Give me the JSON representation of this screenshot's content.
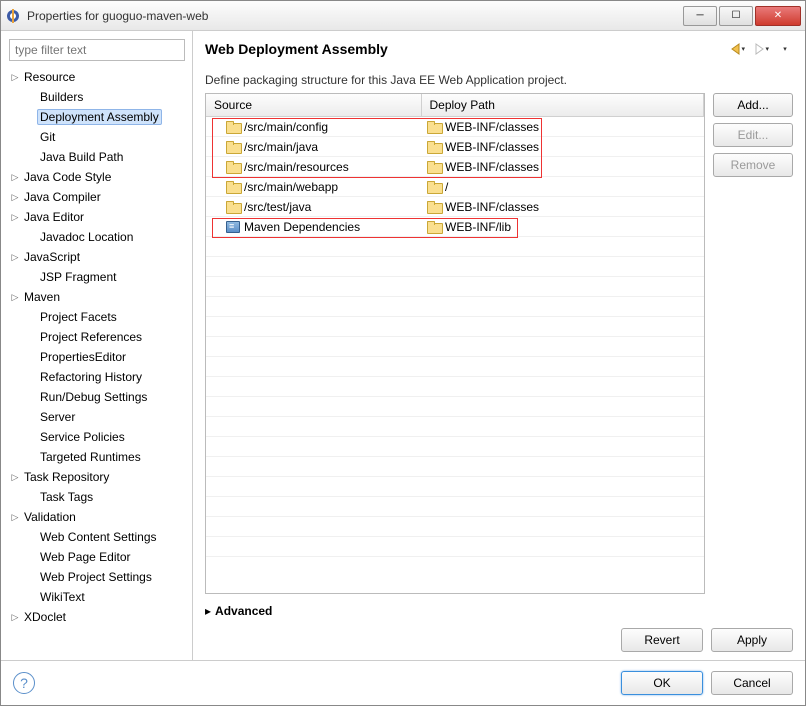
{
  "window": {
    "title": "Properties for guoguo-maven-web"
  },
  "sidebar": {
    "filter_placeholder": "type filter text",
    "items": [
      {
        "label": "Resource",
        "expandable": true,
        "depth": 0
      },
      {
        "label": "Builders",
        "expandable": false,
        "depth": 1
      },
      {
        "label": "Deployment Assembly",
        "expandable": false,
        "depth": 1,
        "selected": true
      },
      {
        "label": "Git",
        "expandable": false,
        "depth": 1
      },
      {
        "label": "Java Build Path",
        "expandable": false,
        "depth": 1
      },
      {
        "label": "Java Code Style",
        "expandable": true,
        "depth": 0
      },
      {
        "label": "Java Compiler",
        "expandable": true,
        "depth": 0
      },
      {
        "label": "Java Editor",
        "expandable": true,
        "depth": 0
      },
      {
        "label": "Javadoc Location",
        "expandable": false,
        "depth": 1
      },
      {
        "label": "JavaScript",
        "expandable": true,
        "depth": 0
      },
      {
        "label": "JSP Fragment",
        "expandable": false,
        "depth": 1
      },
      {
        "label": "Maven",
        "expandable": true,
        "depth": 0
      },
      {
        "label": "Project Facets",
        "expandable": false,
        "depth": 1
      },
      {
        "label": "Project References",
        "expandable": false,
        "depth": 1
      },
      {
        "label": "PropertiesEditor",
        "expandable": false,
        "depth": 1
      },
      {
        "label": "Refactoring History",
        "expandable": false,
        "depth": 1
      },
      {
        "label": "Run/Debug Settings",
        "expandable": false,
        "depth": 1
      },
      {
        "label": "Server",
        "expandable": false,
        "depth": 1
      },
      {
        "label": "Service Policies",
        "expandable": false,
        "depth": 1
      },
      {
        "label": "Targeted Runtimes",
        "expandable": false,
        "depth": 1
      },
      {
        "label": "Task Repository",
        "expandable": true,
        "depth": 0
      },
      {
        "label": "Task Tags",
        "expandable": false,
        "depth": 1
      },
      {
        "label": "Validation",
        "expandable": true,
        "depth": 0
      },
      {
        "label": "Web Content Settings",
        "expandable": false,
        "depth": 1
      },
      {
        "label": "Web Page Editor",
        "expandable": false,
        "depth": 1
      },
      {
        "label": "Web Project Settings",
        "expandable": false,
        "depth": 1
      },
      {
        "label": "WikiText",
        "expandable": false,
        "depth": 1
      },
      {
        "label": "XDoclet",
        "expandable": true,
        "depth": 0
      }
    ]
  },
  "content": {
    "title": "Web Deployment Assembly",
    "description": "Define packaging structure for this Java EE Web Application project.",
    "columns": {
      "source": "Source",
      "deploy": "Deploy Path"
    },
    "rows": [
      {
        "icon": "folder",
        "source": "/src/main/config",
        "deploy_icon": "folder",
        "deploy": "WEB-INF/classes"
      },
      {
        "icon": "folder",
        "source": "/src/main/java",
        "deploy_icon": "folder",
        "deploy": "WEB-INF/classes"
      },
      {
        "icon": "folder",
        "source": "/src/main/resources",
        "deploy_icon": "folder",
        "deploy": "WEB-INF/classes"
      },
      {
        "icon": "folder",
        "source": "/src/main/webapp",
        "deploy_icon": "folder",
        "deploy": "/"
      },
      {
        "icon": "folder",
        "source": "/src/test/java",
        "deploy_icon": "folder",
        "deploy": "WEB-INF/classes"
      },
      {
        "icon": "jar",
        "source": "Maven Dependencies",
        "deploy_icon": "folder",
        "deploy": "WEB-INF/lib"
      }
    ],
    "advanced_label": "Advanced"
  },
  "buttons": {
    "add": "Add...",
    "edit": "Edit...",
    "remove": "Remove",
    "revert": "Revert",
    "apply": "Apply",
    "ok": "OK",
    "cancel": "Cancel"
  }
}
